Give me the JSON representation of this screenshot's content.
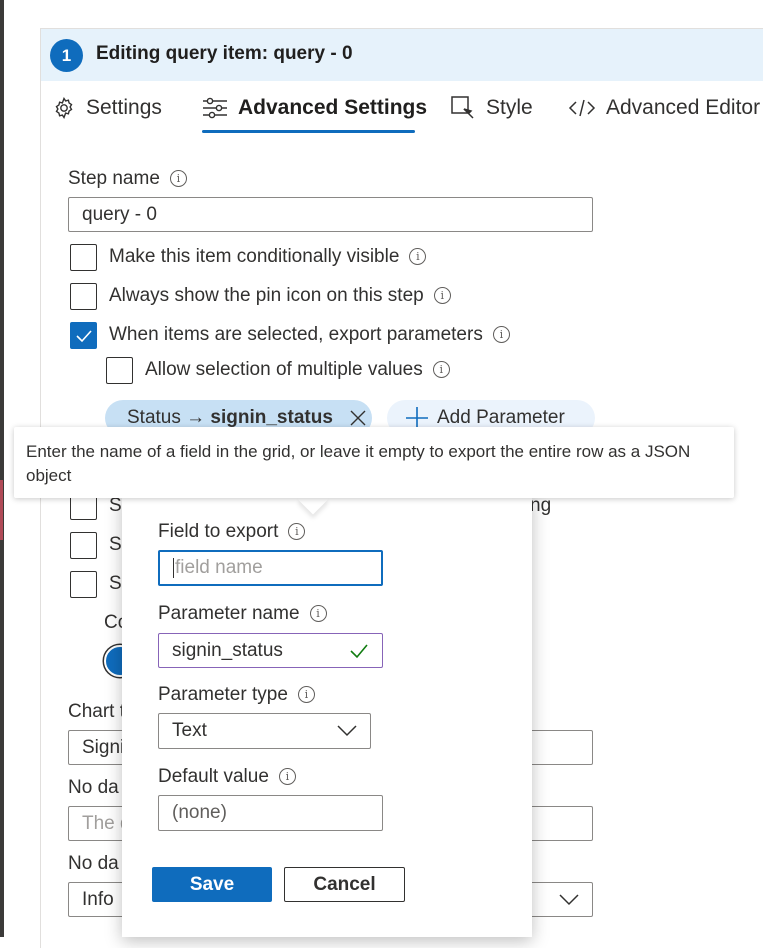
{
  "header": {
    "step_number": "1",
    "title": "Editing query item: query - 0"
  },
  "tabs": [
    {
      "label": "Settings",
      "icon": "gear-icon"
    },
    {
      "label": "Advanced Settings",
      "icon": "sliders-icon",
      "active": true
    },
    {
      "label": "Style",
      "icon": "style-icon"
    },
    {
      "label": "Advanced Editor",
      "icon": "code-icon"
    }
  ],
  "form": {
    "step_name_label": "Step name",
    "step_name_value": "query - 0",
    "options": [
      {
        "label": "Make this item conditionally visible",
        "checked": false
      },
      {
        "label": "Always show the pin icon on this step",
        "checked": false
      },
      {
        "label": "When items are selected, export parameters",
        "checked": true
      }
    ],
    "allow_multiple_label": "Allow selection of multiple values",
    "allow_multiple_checked": false,
    "pill_prefix": "Status → ",
    "pill_param": "signin_status",
    "add_parameter_label": "Add Parameter",
    "behind": {
      "partial_check_1": "Sl",
      "partial_check_2": "Sl",
      "partial_check_3": "Sl",
      "partial_color": "Co",
      "partial_ing": "ng",
      "chart_label": "Chart t",
      "chart_value": "Signi",
      "no_data_label": "No da",
      "no_data_value": "The d",
      "no_data_label2": "No da",
      "no_data_value2": "Info"
    }
  },
  "tooltip": {
    "text": "Enter the name of a field in the grid, or leave it empty to export the entire row as a JSON object"
  },
  "callout": {
    "field_to_export_label": "Field to export",
    "field_to_export_placeholder": "field name",
    "parameter_name_label": "Parameter name",
    "parameter_name_value": "signin_status",
    "parameter_type_label": "Parameter type",
    "parameter_type_value": "Text",
    "default_value_label": "Default value",
    "default_value_placeholder": "(none)",
    "save_label": "Save",
    "cancel_label": "Cancel"
  },
  "colors": {
    "accent": "#0f6cbd",
    "header_bg": "#e6f2fb",
    "pill_bg": "#c7e0f4",
    "valid_check": "#107c10"
  }
}
